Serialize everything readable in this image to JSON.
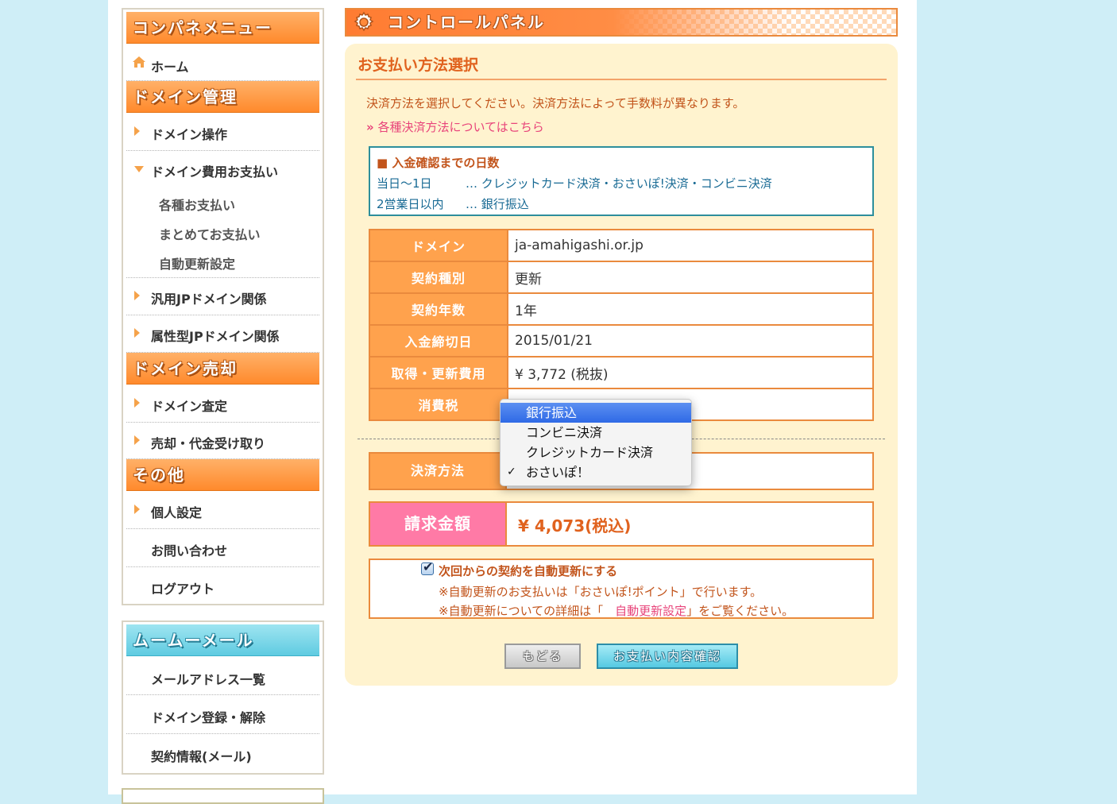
{
  "sidebar": {
    "control_panel_menu": {
      "title": "コンパネメニュー",
      "home": "ホーム",
      "domain_management": {
        "title": "ドメイン管理",
        "items": [
          {
            "label": "ドメイン操作"
          },
          {
            "label": "ドメイン費用お支払い",
            "expanded": true,
            "children": [
              "各種お支払い",
              "まとめてお支払い",
              "自動更新設定"
            ]
          },
          {
            "label": "汎用JPドメイン関係"
          },
          {
            "label": "属性型JPドメイン関係"
          }
        ]
      },
      "domain_sale": {
        "title": "ドメイン売却",
        "items": [
          "ドメイン査定",
          "売却・代金受け取り"
        ]
      },
      "other": {
        "title": "その他",
        "items": [
          "個人設定",
          "お問い合わせ",
          "ログアウト"
        ]
      }
    },
    "mumu_mail": {
      "title": "ムームーメール",
      "items": [
        "メールアドレス一覧",
        "ドメイン登録・解除",
        "契約情報(メール)"
      ]
    }
  },
  "header": {
    "title": "コントロールパネル",
    "icon": "gear-icon"
  },
  "main": {
    "section_title": "お支払い方法選択",
    "intro": "決済方法を選択してください。決済方法によって手数料が異なります。",
    "link_text": "各種決済方法についてはこちら",
    "deposit_info": {
      "title": "入金確認までの日数",
      "rows": [
        {
          "days": "当日〜1日",
          "methods": "… クレジットカード決済・おさいぽ!決済・コンビニ決済"
        },
        {
          "days": "2営業日以内",
          "methods": "… 銀行振込"
        }
      ]
    },
    "details": [
      {
        "label": "ドメイン",
        "value": "ja-amahigashi.or.jp"
      },
      {
        "label": "契約種別",
        "value": "更新"
      },
      {
        "label": "契約年数",
        "value": "1年"
      },
      {
        "label": "入金締切日",
        "value": "2015/01/21"
      },
      {
        "label": "取得・更新費用",
        "value": "¥ 3,772 (税抜)"
      },
      {
        "label": "消費税",
        "value": ""
      }
    ],
    "payment_method": {
      "label": "決済方法",
      "options": [
        "銀行振込",
        "コンビニ決済",
        "クレジットカード決済",
        "おさいぽ！"
      ],
      "highlighted": "銀行振込",
      "checked": "おさいぽ！"
    },
    "total": {
      "label": "請求金額",
      "value": "¥ 4,073(税込)"
    },
    "auto_renew": {
      "checked": true,
      "label": "次回からの契約を自動更新にする",
      "note1": "※自動更新のお支払いは「おさいぽ!ポイント」で行います。",
      "note2_prefix": "※自動更新についての詳細は「",
      "note2_link": "自動更新設定",
      "note2_suffix": "」をご覧ください。"
    },
    "buttons": {
      "back": "もどる",
      "confirm": "お支払い内容確認"
    }
  },
  "colors": {
    "accent": "#ff8a2c",
    "cyan": "#5fcbe1",
    "total_pink": "#ff7aa6",
    "background": "#cfeef7"
  }
}
